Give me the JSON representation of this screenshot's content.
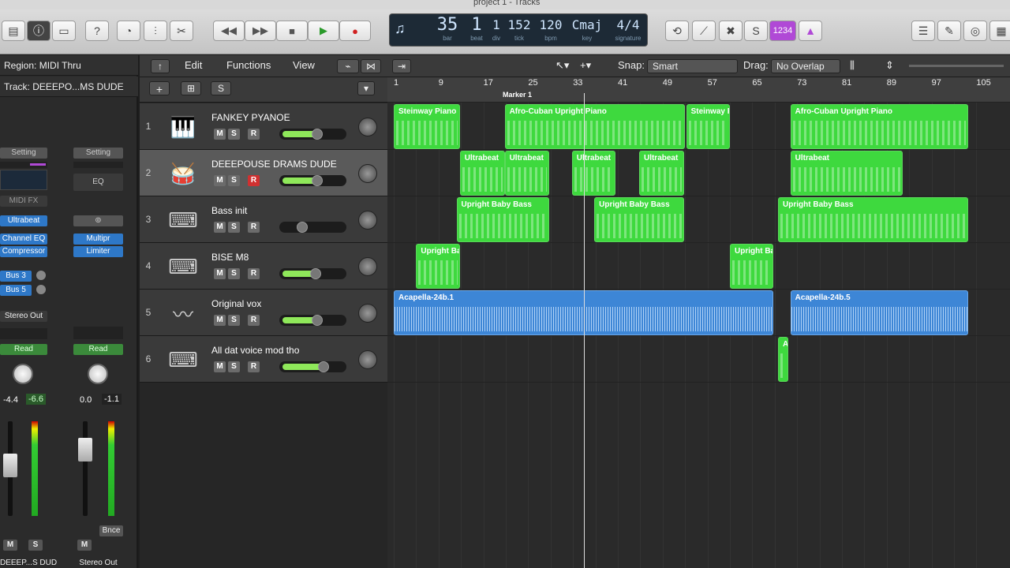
{
  "window": {
    "title": "project 1 - Tracks"
  },
  "lcd": {
    "bar": "35",
    "beat": "1",
    "div": "1",
    "tick": "152",
    "bpm": "120",
    "key": "Cmaj",
    "signature": "4/4",
    "labels": {
      "bar": "bar",
      "beat": "beat",
      "div": "div",
      "tick": "tick",
      "bpm": "bpm",
      "key": "key",
      "signature": "signature"
    }
  },
  "toolbar": {
    "count_in": "1234"
  },
  "inspector": {
    "region_label": "Region: MIDI Thru",
    "track_label": "Track: DEEEPO...MS DUDE",
    "setting": "Setting",
    "eq": "EQ",
    "midi_fx": "MIDI FX",
    "instrument": "Ultrabeat",
    "plugins": [
      "Channel EQ",
      "Compressor"
    ],
    "plugins2": [
      "Multipr",
      "Limiter"
    ],
    "sends": [
      "Bus 3",
      "Bus 5"
    ],
    "output": "Stereo Out",
    "automation": "Read",
    "automation2": "Read",
    "gain1": "-4.4",
    "peak1": "-6.6",
    "gain2": "0.0",
    "peak2": "-1.1",
    "bounce": "Bnce",
    "m": "M",
    "s": "S",
    "strip1_name": "DEEEP...S DUDE",
    "strip2_name": "Stereo Out"
  },
  "header": {
    "menus": [
      "Edit",
      "Functions",
      "View"
    ],
    "snap_label": "Snap:",
    "snap_value": "Smart",
    "drag_label": "Drag:",
    "drag_value": "No Overlap",
    "s_button": "S"
  },
  "tracks": [
    {
      "num": "1",
      "name": "FANKEY PYANOE",
      "icon": "grand-piano-icon",
      "vol": 0.62,
      "rec": false
    },
    {
      "num": "2",
      "name": "DEEEPOUSE DRAMS DUDE",
      "icon": "drum-kit-icon",
      "vol": 0.62,
      "rec": true
    },
    {
      "num": "3",
      "name": "Bass init",
      "icon": "keyboard-stand-icon",
      "vol": 0.4,
      "rec": false
    },
    {
      "num": "4",
      "name": "BISE M8",
      "icon": "keyboard-stand-icon",
      "vol": 0.6,
      "rec": false
    },
    {
      "num": "5",
      "name": "Original vox",
      "icon": "audio-waveform-icon",
      "vol": 0.62,
      "rec": false
    },
    {
      "num": "6",
      "name": "All dat voice mod tho",
      "icon": "keyboard-stand-icon",
      "vol": 0.72,
      "rec": false
    }
  ],
  "track_buttons": {
    "m": "M",
    "s": "S",
    "r": "R"
  },
  "ruler": {
    "ticks": [
      "1",
      "9",
      "17",
      "25",
      "33",
      "41",
      "49",
      "57",
      "65",
      "73",
      "81",
      "89",
      "97",
      "105"
    ],
    "marker": "Marker 1"
  },
  "regions": [
    {
      "lane": 0,
      "name": "Steinway Piano",
      "type": "midi",
      "start": 1,
      "end": 12.8
    },
    {
      "lane": 0,
      "name": "Afro-Cuban Upright Piano",
      "type": "midi",
      "start": 20.8,
      "end": 53
    },
    {
      "lane": 0,
      "name": "Steinway Piano",
      "type": "midi",
      "start": 53.2,
      "end": 61
    },
    {
      "lane": 0,
      "name": "Afro-Cuban Upright Piano",
      "type": "midi",
      "start": 71.8,
      "end": 103.6
    },
    {
      "lane": 1,
      "name": "Ultrabeat",
      "type": "midi",
      "start": 12.8,
      "end": 20.8
    },
    {
      "lane": 1,
      "name": "Ultrabeat",
      "type": "midi",
      "start": 20.8,
      "end": 28.8
    },
    {
      "lane": 1,
      "name": "Ultrabeat",
      "type": "midi",
      "start": 32.8,
      "end": 40.6
    },
    {
      "lane": 1,
      "name": "Ultrabeat",
      "type": "midi",
      "start": 44.8,
      "end": 52.8
    },
    {
      "lane": 1,
      "name": "Ultrabeat",
      "type": "midi",
      "start": 71.8,
      "end": 91.8
    },
    {
      "lane": 2,
      "name": "Upright Baby Bass",
      "type": "midi",
      "start": 12.2,
      "end": 28.8
    },
    {
      "lane": 2,
      "name": "Upright Baby Bass",
      "type": "midi",
      "start": 36.8,
      "end": 52.8
    },
    {
      "lane": 2,
      "name": "Upright Baby Bass",
      "type": "midi",
      "start": 69.6,
      "end": 103.6
    },
    {
      "lane": 3,
      "name": "Upright Ba",
      "type": "midi",
      "start": 5,
      "end": 12.8
    },
    {
      "lane": 3,
      "name": "Upright Ba",
      "type": "midi",
      "start": 61,
      "end": 68.8
    },
    {
      "lane": 4,
      "name": "Acapella-24b.1",
      "type": "audio",
      "start": 1,
      "end": 68.8
    },
    {
      "lane": 4,
      "name": "Acapella-24b.5",
      "type": "audio",
      "start": 71.8,
      "end": 103.6
    },
    {
      "lane": 5,
      "name": "A",
      "type": "midi",
      "start": 69.6,
      "end": 71.4
    }
  ],
  "playhead_bar": 35,
  "colors": {
    "midi_region": "#3ed93e",
    "audio_region": "#3d86d6",
    "count_in": "#b049d6"
  }
}
